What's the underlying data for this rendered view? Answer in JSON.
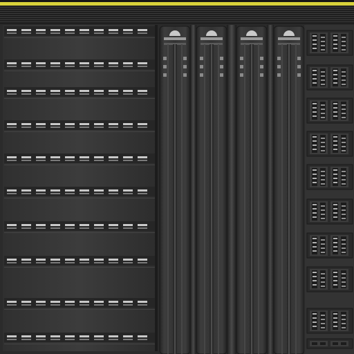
{
  "texture": {
    "accent_color": "#d8d13a",
    "base_color": "#2f2f2f",
    "panel_color": "#3a3a3a",
    "groove_color": "#1e1e1e",
    "light_color": "#c9c9c9",
    "left_grille": {
      "row_count": 10,
      "bars_per_row": 10
    },
    "vertical_modules": {
      "count": 4
    },
    "right_racks": {
      "row_count": 10
    }
  }
}
